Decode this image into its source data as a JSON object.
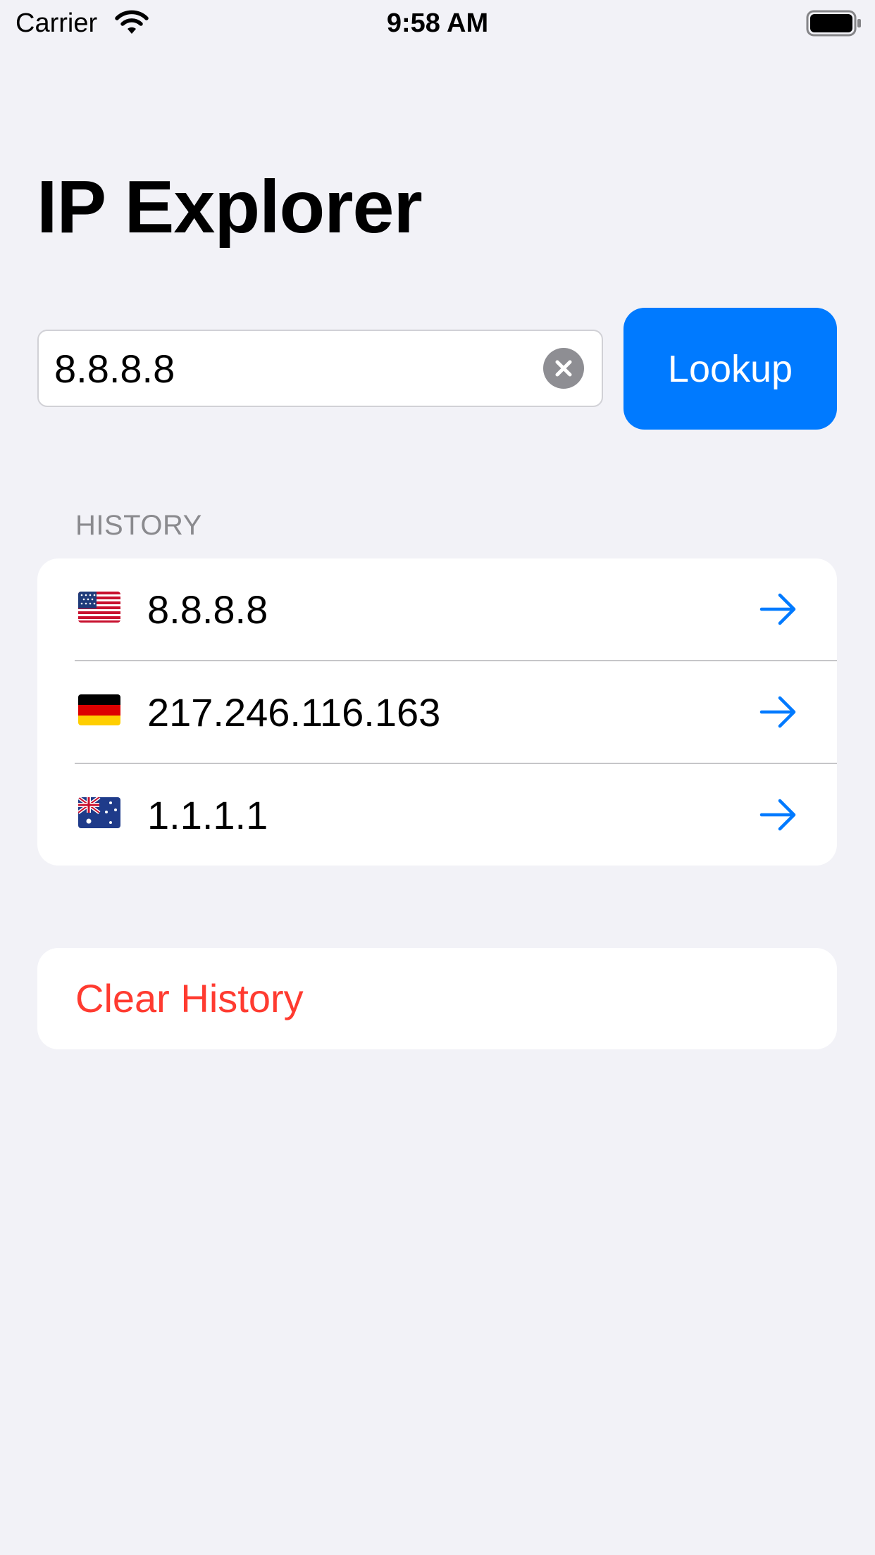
{
  "status_bar": {
    "carrier": "Carrier",
    "time": "9:58 AM",
    "wifi_icon": "wifi-icon",
    "battery_icon": "battery-icon"
  },
  "title": "IP Explorer",
  "search": {
    "value": "8.8.8.8",
    "clear_icon": "clear-circle-icon"
  },
  "lookup_button": {
    "label": "Lookup",
    "color": "#007AFF"
  },
  "history": {
    "header": "HISTORY",
    "items": [
      {
        "flag": "us-flag-icon",
        "ip": "8.8.8.8",
        "arrow_icon": "arrow-right-icon"
      },
      {
        "flag": "de-flag-icon",
        "ip": "217.246.116.163",
        "arrow_icon": "arrow-right-icon"
      },
      {
        "flag": "au-flag-icon",
        "ip": "1.1.1.1",
        "arrow_icon": "arrow-right-icon"
      }
    ]
  },
  "clear_history": {
    "label": "Clear History",
    "color": "#FF3B30"
  },
  "colors": {
    "background": "#F2F2F7",
    "accent": "#007AFF",
    "destructive": "#FF3B30",
    "secondary_text": "#8A8A8E"
  }
}
